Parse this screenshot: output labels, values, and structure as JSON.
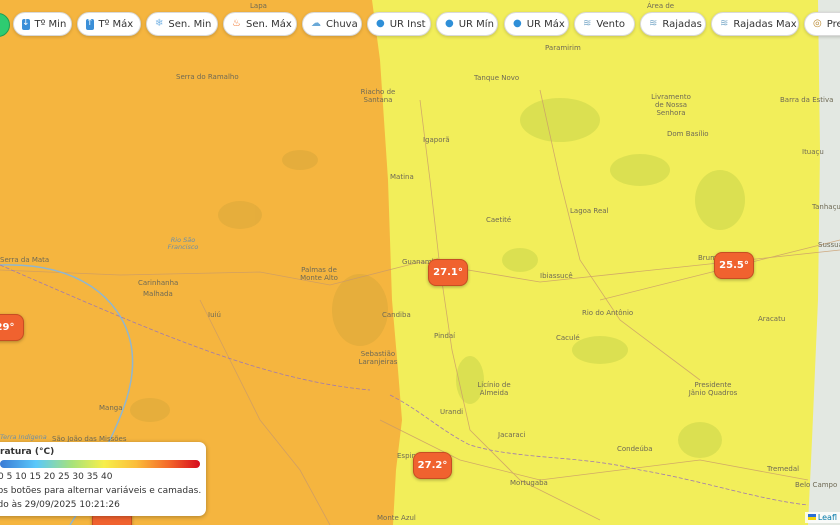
{
  "toolbar": {
    "buttons": [
      {
        "label": "Tº Min",
        "icon": "down-arrow-icon"
      },
      {
        "label": "Tº Máx",
        "icon": "up-arrow-icon"
      },
      {
        "label": "Sen. Min",
        "icon": "snowflake-icon"
      },
      {
        "label": "Sen. Máx",
        "icon": "fire-icon"
      },
      {
        "label": "Chuva",
        "icon": "rain-cloud-icon"
      },
      {
        "label": "UR Inst",
        "icon": "droplet-icon"
      },
      {
        "label": "UR Mín",
        "icon": "droplet-icon"
      },
      {
        "label": "UR Máx",
        "icon": "droplet-icon"
      },
      {
        "label": "Vento",
        "icon": "wind-icon"
      },
      {
        "label": "Rajadas",
        "icon": "wind-icon"
      },
      {
        "label": "Rajadas Max",
        "icon": "wind-icon"
      },
      {
        "label": "Pre",
        "icon": "gauge-icon"
      }
    ]
  },
  "map": {
    "colors": {
      "warm_zone": "#f5b53f",
      "mild_zone": "#f2ee5a",
      "badge": "#f0622f"
    },
    "places": [
      "Serra do Ramalho",
      "Riacho de Santana",
      "Tanque Novo",
      "Paramirim",
      "Livramento de Nossa Senhora",
      "Dom Basílio",
      "Barra da Estiva",
      "Ituaçu",
      "Igaporã",
      "Matina",
      "Caetité",
      "Lagoa Real",
      "Guanambi",
      "Ibiassucê",
      "Brumado",
      "Tanhaçu",
      "Sussuarana",
      "Carinhanha",
      "Malhada",
      "Palmas de Monte Alto",
      "Iuiú",
      "Candiba",
      "Sebastião Laranjeiras",
      "Pindaí",
      "Rio do Antônio",
      "Caculé",
      "Aracatu",
      "Licínio de Almeida",
      "Urandi",
      "Presidente Jânio Quadros",
      "Manga",
      "Jacaraci",
      "Condeúba",
      "Espinosa",
      "Mortugaba",
      "Tremedal",
      "Belo Campo",
      "Monte Azul",
      "São João das Missões",
      "Serra da Mata",
      "Área de",
      "Lapa"
    ],
    "rivers": [
      "Rio São Francisco",
      "Terra Indígena"
    ]
  },
  "badges": [
    {
      "value": "27.1°"
    },
    {
      "value": "25.5°"
    },
    {
      "value": "29°"
    },
    {
      "value": "27.2°"
    }
  ],
  "legend": {
    "title": "ratura (°C)",
    "ticks": "0 5 10 15 20 25 30 35 40",
    "hint": "nos botões para alternar variáveis e camadas.",
    "updated": "ado às 29/09/2025 10:21:26"
  },
  "attribution": "Leafl"
}
